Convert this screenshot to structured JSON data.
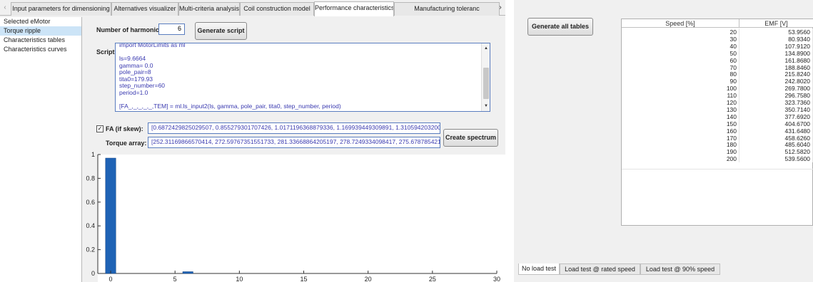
{
  "left": {
    "tabs": [
      "Input parameters for dimensioning",
      "Alternatives visualizer",
      "Multi-criteria analysis",
      "Coil construction model",
      "Performance characteristics",
      "Manufacturing toleranc"
    ],
    "active_tab": 4,
    "sidebar": [
      "Selected eMotor",
      "Torque ripple",
      "Characteristics tables",
      "Characteristics curves"
    ],
    "selected_sidebar": 1,
    "harmonic_label": "Number of harmonic",
    "harmonic_value": "6",
    "generate_script_label": "Generate script",
    "script_label": "Script:",
    "script_lines": [
      "import MotorLimits as ml",
      "",
      "ls=9.6664",
      "gamma= 0.0",
      "pole_pair=8",
      "tita0=179.93",
      "step_number=60",
      "period=1.0",
      "",
      "[FA_,_,_,_,_,TEM] = ml.ls_input2(ls, gamma, pole_pair, tita0, step_number, period)"
    ],
    "fa_label": "FA (if skew):",
    "fa_checked": true,
    "fa_value": "[0.6872429825029507, 0.855279301707426, 1.0171196368879336, 1.169939449309891, 1.3105942032008",
    "torque_label": "Torque array:",
    "torque_value": "[252.31169866570414, 272.59767351551733, 281.33668864205197, 278.7249334098417, 275.6787854215",
    "create_spectrum_label": "Create spectrum"
  },
  "chart_data": {
    "type": "bar",
    "x": [
      0,
      6
    ],
    "values": [
      0.97,
      0.015
    ],
    "xlim": [
      -1,
      30
    ],
    "ylim": [
      0,
      1
    ],
    "xticks": [
      "0",
      "5",
      "10",
      "15",
      "20",
      "25",
      "30"
    ],
    "yticks": [
      "0",
      "0.2",
      "0.4",
      "0.6",
      "0.8",
      "1"
    ],
    "bar_color": "#1f63b5"
  },
  "right": {
    "generate_all_label": "Generate all tables",
    "columns": [
      "Speed [%]",
      "EMF [V]"
    ],
    "rows": [
      [
        "20",
        "53.9560"
      ],
      [
        "30",
        "80.9340"
      ],
      [
        "40",
        "107.9120"
      ],
      [
        "50",
        "134.8900"
      ],
      [
        "60",
        "161.8680"
      ],
      [
        "70",
        "188.8460"
      ],
      [
        "80",
        "215.8240"
      ],
      [
        "90",
        "242.8020"
      ],
      [
        "100",
        "269.7800"
      ],
      [
        "110",
        "296.7580"
      ],
      [
        "120",
        "323.7360"
      ],
      [
        "130",
        "350.7140"
      ],
      [
        "140",
        "377.6920"
      ],
      [
        "150",
        "404.6700"
      ],
      [
        "160",
        "431.6480"
      ],
      [
        "170",
        "458.6260"
      ],
      [
        "180",
        "485.6040"
      ],
      [
        "190",
        "512.5820"
      ],
      [
        "200",
        "539.5600"
      ]
    ],
    "bottom_tabs": [
      "No load test",
      "Load test @ rated speed",
      "Load test @ 90% speed"
    ],
    "active_bottom_tab": 0
  }
}
